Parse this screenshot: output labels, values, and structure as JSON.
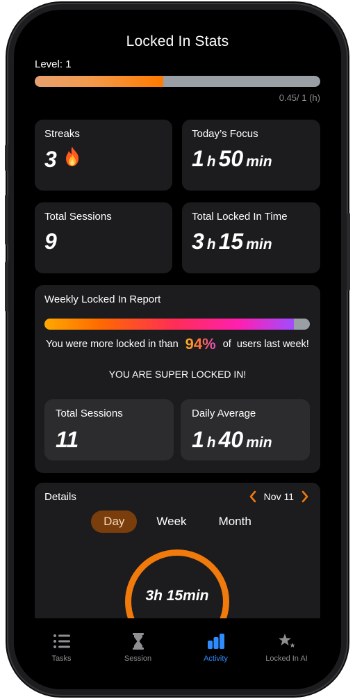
{
  "page": {
    "title": "Locked In Stats"
  },
  "level": {
    "label": "Level: 1",
    "progress_fraction": 0.45,
    "progress_text": "0.45/ 1 (h)"
  },
  "stats": {
    "streaks": {
      "label": "Streaks",
      "value": "3",
      "icon": "fire-icon"
    },
    "todays_focus": {
      "label": "Today’s Focus",
      "hours": "1",
      "hours_unit": "h",
      "minutes": "50",
      "minutes_unit": "min"
    },
    "total_sessions": {
      "label": "Total Sessions",
      "value": "9"
    },
    "total_locked_time": {
      "label": "Total Locked In Time",
      "hours": "3",
      "hours_unit": "h",
      "minutes": "15",
      "minutes_unit": "min"
    }
  },
  "weekly": {
    "title": "Weekly Locked In Report",
    "progress_fraction": 0.94,
    "compare_prefix": "You were more locked in than",
    "percent": "94%",
    "compare_suffix": "of  users last week!",
    "headline": "YOU ARE SUPER LOCKED IN!",
    "total_sessions": {
      "label": "Total Sessions",
      "value": "11"
    },
    "daily_average": {
      "label": "Daily Average",
      "hours": "1",
      "hours_unit": "h",
      "minutes": "40",
      "minutes_unit": "min"
    }
  },
  "details": {
    "label": "Details",
    "date": "Nov 11",
    "tabs": [
      {
        "label": "Day",
        "active": true
      },
      {
        "label": "Week",
        "active": false
      },
      {
        "label": "Month",
        "active": false
      }
    ],
    "ring_value": "3h 15min"
  },
  "tabbar": {
    "items": [
      {
        "label": "Tasks",
        "icon": "list-icon",
        "active": false
      },
      {
        "label": "Session",
        "icon": "hourglass-icon",
        "active": false
      },
      {
        "label": "Activity",
        "icon": "bar-chart-icon",
        "active": true
      },
      {
        "label": "Locked In AI",
        "icon": "sparkle-stars-icon",
        "active": false
      }
    ]
  },
  "colors": {
    "accent_orange": "#f07a0c",
    "active_tab_blue": "#2f8cff",
    "card_bg": "#1c1c1e"
  }
}
